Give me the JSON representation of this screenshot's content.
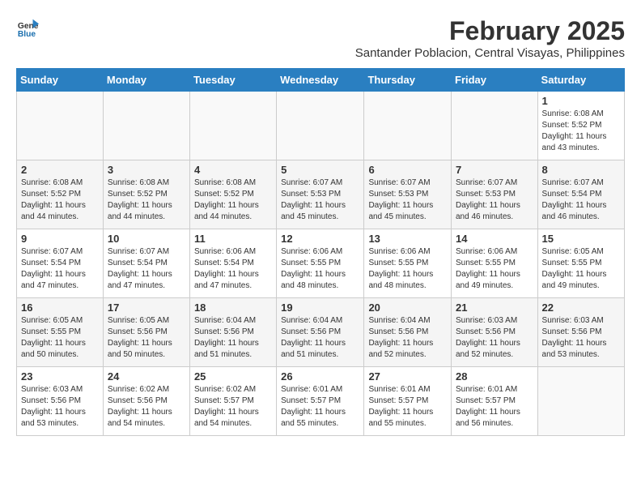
{
  "header": {
    "logo_line1": "General",
    "logo_line2": "Blue",
    "title": "February 2025",
    "subtitle": "Santander Poblacion, Central Visayas, Philippines"
  },
  "weekdays": [
    "Sunday",
    "Monday",
    "Tuesday",
    "Wednesday",
    "Thursday",
    "Friday",
    "Saturday"
  ],
  "weeks": [
    [
      {
        "day": "",
        "info": ""
      },
      {
        "day": "",
        "info": ""
      },
      {
        "day": "",
        "info": ""
      },
      {
        "day": "",
        "info": ""
      },
      {
        "day": "",
        "info": ""
      },
      {
        "day": "",
        "info": ""
      },
      {
        "day": "1",
        "info": "Sunrise: 6:08 AM\nSunset: 5:52 PM\nDaylight: 11 hours and 43 minutes."
      }
    ],
    [
      {
        "day": "2",
        "info": "Sunrise: 6:08 AM\nSunset: 5:52 PM\nDaylight: 11 hours and 44 minutes."
      },
      {
        "day": "3",
        "info": "Sunrise: 6:08 AM\nSunset: 5:52 PM\nDaylight: 11 hours and 44 minutes."
      },
      {
        "day": "4",
        "info": "Sunrise: 6:08 AM\nSunset: 5:52 PM\nDaylight: 11 hours and 44 minutes."
      },
      {
        "day": "5",
        "info": "Sunrise: 6:07 AM\nSunset: 5:53 PM\nDaylight: 11 hours and 45 minutes."
      },
      {
        "day": "6",
        "info": "Sunrise: 6:07 AM\nSunset: 5:53 PM\nDaylight: 11 hours and 45 minutes."
      },
      {
        "day": "7",
        "info": "Sunrise: 6:07 AM\nSunset: 5:53 PM\nDaylight: 11 hours and 46 minutes."
      },
      {
        "day": "8",
        "info": "Sunrise: 6:07 AM\nSunset: 5:54 PM\nDaylight: 11 hours and 46 minutes."
      }
    ],
    [
      {
        "day": "9",
        "info": "Sunrise: 6:07 AM\nSunset: 5:54 PM\nDaylight: 11 hours and 47 minutes."
      },
      {
        "day": "10",
        "info": "Sunrise: 6:07 AM\nSunset: 5:54 PM\nDaylight: 11 hours and 47 minutes."
      },
      {
        "day": "11",
        "info": "Sunrise: 6:06 AM\nSunset: 5:54 PM\nDaylight: 11 hours and 47 minutes."
      },
      {
        "day": "12",
        "info": "Sunrise: 6:06 AM\nSunset: 5:55 PM\nDaylight: 11 hours and 48 minutes."
      },
      {
        "day": "13",
        "info": "Sunrise: 6:06 AM\nSunset: 5:55 PM\nDaylight: 11 hours and 48 minutes."
      },
      {
        "day": "14",
        "info": "Sunrise: 6:06 AM\nSunset: 5:55 PM\nDaylight: 11 hours and 49 minutes."
      },
      {
        "day": "15",
        "info": "Sunrise: 6:05 AM\nSunset: 5:55 PM\nDaylight: 11 hours and 49 minutes."
      }
    ],
    [
      {
        "day": "16",
        "info": "Sunrise: 6:05 AM\nSunset: 5:55 PM\nDaylight: 11 hours and 50 minutes."
      },
      {
        "day": "17",
        "info": "Sunrise: 6:05 AM\nSunset: 5:56 PM\nDaylight: 11 hours and 50 minutes."
      },
      {
        "day": "18",
        "info": "Sunrise: 6:04 AM\nSunset: 5:56 PM\nDaylight: 11 hours and 51 minutes."
      },
      {
        "day": "19",
        "info": "Sunrise: 6:04 AM\nSunset: 5:56 PM\nDaylight: 11 hours and 51 minutes."
      },
      {
        "day": "20",
        "info": "Sunrise: 6:04 AM\nSunset: 5:56 PM\nDaylight: 11 hours and 52 minutes."
      },
      {
        "day": "21",
        "info": "Sunrise: 6:03 AM\nSunset: 5:56 PM\nDaylight: 11 hours and 52 minutes."
      },
      {
        "day": "22",
        "info": "Sunrise: 6:03 AM\nSunset: 5:56 PM\nDaylight: 11 hours and 53 minutes."
      }
    ],
    [
      {
        "day": "23",
        "info": "Sunrise: 6:03 AM\nSunset: 5:56 PM\nDaylight: 11 hours and 53 minutes."
      },
      {
        "day": "24",
        "info": "Sunrise: 6:02 AM\nSunset: 5:56 PM\nDaylight: 11 hours and 54 minutes."
      },
      {
        "day": "25",
        "info": "Sunrise: 6:02 AM\nSunset: 5:57 PM\nDaylight: 11 hours and 54 minutes."
      },
      {
        "day": "26",
        "info": "Sunrise: 6:01 AM\nSunset: 5:57 PM\nDaylight: 11 hours and 55 minutes."
      },
      {
        "day": "27",
        "info": "Sunrise: 6:01 AM\nSunset: 5:57 PM\nDaylight: 11 hours and 55 minutes."
      },
      {
        "day": "28",
        "info": "Sunrise: 6:01 AM\nSunset: 5:57 PM\nDaylight: 11 hours and 56 minutes."
      },
      {
        "day": "",
        "info": ""
      }
    ]
  ]
}
